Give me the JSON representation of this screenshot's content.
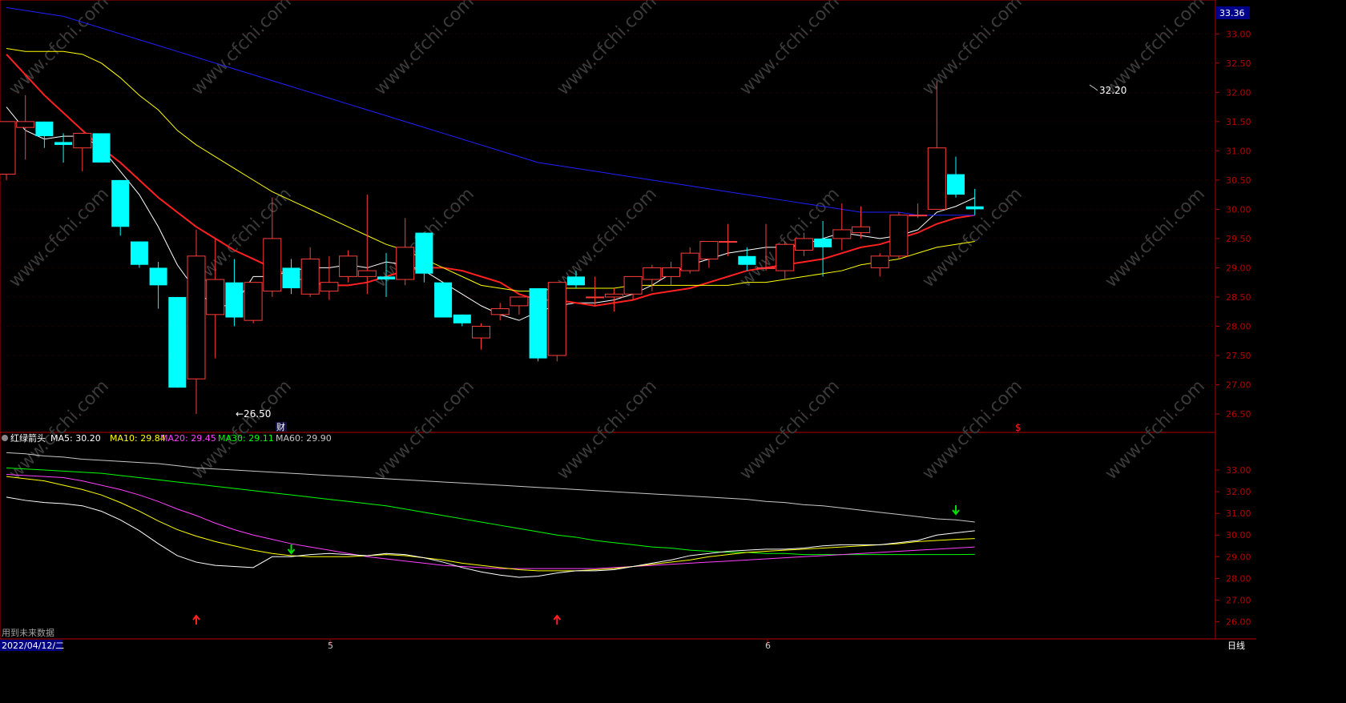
{
  "colors": {
    "background": "#000000",
    "up": "#ff3c3c",
    "down": "#00ffff",
    "grid": "#3a0000",
    "axis": "#b40000",
    "ma5": "#ffffff",
    "ma10": "#ffff00",
    "ma20": "#ff40ff",
    "ma30": "#00ff00",
    "ma60": "#c8c8c8",
    "ma60_main": "#2020ff",
    "ma20_main": "#ff2020"
  },
  "price_axis": {
    "current": "33.36",
    "ticks": [
      "33.00",
      "32.50",
      "32.00",
      "31.50",
      "31.00",
      "30.50",
      "30.00",
      "29.50",
      "29.00",
      "28.50",
      "28.00",
      "27.50",
      "27.00",
      "26.50"
    ]
  },
  "indicator_axis": {
    "ticks": [
      "33.00",
      "32.00",
      "31.00",
      "30.00",
      "29.00",
      "28.00",
      "27.00",
      "26.00"
    ]
  },
  "annotations": {
    "high_label": "32.20",
    "low_label": "←26.50",
    "finance_marker": "财",
    "dollar_marker": "$"
  },
  "indicator_legend": {
    "name": "红绿箭头",
    "ma5": "MA5: 30.20",
    "ma10": "MA10: 29.84",
    "ma20": "MA20: 29.45",
    "ma30": "MA30: 29.11",
    "ma60": "MA60: 29.90"
  },
  "footer": {
    "future_data": "用到未来数据",
    "date": "2022/04/12/二",
    "month5": "5",
    "month6": "6",
    "period": "日线"
  },
  "chart_data": {
    "type": "candlestick",
    "ylim": [
      26.3,
      33.5
    ],
    "candles": [
      {
        "o": 30.6,
        "h": 31.2,
        "l": 30.5,
        "c": 31.5
      },
      {
        "o": 31.4,
        "h": 31.95,
        "l": 30.85,
        "c": 31.5
      },
      {
        "o": 31.5,
        "h": 31.5,
        "l": 31.05,
        "c": 31.25
      },
      {
        "o": 31.15,
        "h": 31.3,
        "l": 30.8,
        "c": 31.1
      },
      {
        "o": 31.05,
        "h": 31.3,
        "l": 30.65,
        "c": 31.3
      },
      {
        "o": 31.3,
        "h": 31.3,
        "l": 30.8,
        "c": 30.8
      },
      {
        "o": 30.5,
        "h": 30.5,
        "l": 29.55,
        "c": 29.7
      },
      {
        "o": 29.45,
        "h": 29.45,
        "l": 29.0,
        "c": 29.05
      },
      {
        "o": 29.0,
        "h": 29.1,
        "l": 28.3,
        "c": 28.7
      },
      {
        "o": 28.5,
        "h": 28.5,
        "l": 26.95,
        "c": 26.95
      },
      {
        "o": 27.1,
        "h": 29.65,
        "l": 26.5,
        "c": 29.2
      },
      {
        "o": 28.2,
        "h": 29.5,
        "l": 27.45,
        "c": 28.8
      },
      {
        "o": 28.75,
        "h": 29.15,
        "l": 28.0,
        "c": 28.15
      },
      {
        "o": 28.1,
        "h": 28.75,
        "l": 28.05,
        "c": 28.75
      },
      {
        "o": 28.6,
        "h": 30.2,
        "l": 28.5,
        "c": 29.5
      },
      {
        "o": 29.0,
        "h": 29.15,
        "l": 28.55,
        "c": 28.65
      },
      {
        "o": 28.55,
        "h": 29.35,
        "l": 28.5,
        "c": 29.15
      },
      {
        "o": 28.6,
        "h": 29.2,
        "l": 28.45,
        "c": 28.75
      },
      {
        "o": 28.85,
        "h": 29.3,
        "l": 28.75,
        "c": 29.2
      },
      {
        "o": 28.85,
        "h": 30.25,
        "l": 28.55,
        "c": 28.95
      },
      {
        "o": 28.85,
        "h": 29.25,
        "l": 28.5,
        "c": 28.8
      },
      {
        "o": 28.8,
        "h": 29.85,
        "l": 28.7,
        "c": 29.35
      },
      {
        "o": 29.6,
        "h": 29.6,
        "l": 28.75,
        "c": 28.9
      },
      {
        "o": 28.75,
        "h": 28.75,
        "l": 28.15,
        "c": 28.15
      },
      {
        "o": 28.2,
        "h": 28.2,
        "l": 28.0,
        "c": 28.05
      },
      {
        "o": 27.8,
        "h": 28.05,
        "l": 27.6,
        "c": 28.0
      },
      {
        "o": 28.2,
        "h": 28.4,
        "l": 28.1,
        "c": 28.3
      },
      {
        "o": 28.35,
        "h": 28.5,
        "l": 28.2,
        "c": 28.5
      },
      {
        "o": 28.65,
        "h": 28.65,
        "l": 27.4,
        "c": 27.45
      },
      {
        "o": 27.5,
        "h": 28.75,
        "l": 27.4,
        "c": 28.75
      },
      {
        "o": 28.85,
        "h": 28.95,
        "l": 28.65,
        "c": 28.7
      },
      {
        "o": 28.5,
        "h": 28.85,
        "l": 28.35,
        "c": 28.5
      },
      {
        "o": 28.5,
        "h": 28.65,
        "l": 28.25,
        "c": 28.55
      },
      {
        "o": 28.55,
        "h": 28.8,
        "l": 28.45,
        "c": 28.85
      },
      {
        "o": 28.8,
        "h": 29.05,
        "l": 28.6,
        "c": 29.0
      },
      {
        "o": 28.85,
        "h": 29.1,
        "l": 28.7,
        "c": 29.0
      },
      {
        "o": 28.95,
        "h": 29.35,
        "l": 28.9,
        "c": 29.25
      },
      {
        "o": 29.15,
        "h": 29.45,
        "l": 29.0,
        "c": 29.45
      },
      {
        "o": 29.45,
        "h": 29.75,
        "l": 29.2,
        "c": 29.45
      },
      {
        "o": 29.2,
        "h": 29.35,
        "l": 28.95,
        "c": 29.05
      },
      {
        "o": 29.0,
        "h": 29.75,
        "l": 28.95,
        "c": 29.0
      },
      {
        "o": 28.95,
        "h": 29.45,
        "l": 28.8,
        "c": 29.4
      },
      {
        "o": 29.3,
        "h": 29.6,
        "l": 29.2,
        "c": 29.5
      },
      {
        "o": 29.5,
        "h": 29.8,
        "l": 28.85,
        "c": 29.35
      },
      {
        "o": 29.5,
        "h": 30.1,
        "l": 29.3,
        "c": 29.65
      },
      {
        "o": 29.6,
        "h": 30.05,
        "l": 29.5,
        "c": 29.7
      },
      {
        "o": 29.0,
        "h": 29.25,
        "l": 28.85,
        "c": 29.2
      },
      {
        "o": 29.2,
        "h": 29.95,
        "l": 29.15,
        "c": 29.9
      },
      {
        "o": 29.9,
        "h": 30.1,
        "l": 29.85,
        "c": 29.9
      },
      {
        "o": 30.0,
        "h": 32.2,
        "l": 30.0,
        "c": 31.05
      },
      {
        "o": 30.6,
        "h": 30.9,
        "l": 30.2,
        "c": 30.25
      },
      {
        "o": 30.05,
        "h": 30.35,
        "l": 29.9,
        "c": 30.0
      }
    ],
    "overlays_main": [
      {
        "name": "MA5",
        "color": "#ffffff",
        "values": [
          31.75,
          31.35,
          31.2,
          31.25,
          31.25,
          31.05,
          30.65,
          30.25,
          29.7,
          29.05,
          28.6,
          28.35,
          28.35,
          28.85,
          28.85,
          28.95,
          29.0,
          29.0,
          29.05,
          29.0,
          29.1,
          29.05,
          28.95,
          28.75,
          28.55,
          28.35,
          28.2,
          28.1,
          28.25,
          28.35,
          28.4,
          28.4,
          28.45,
          28.55,
          28.7,
          28.9,
          29.05,
          29.15,
          29.25,
          29.3,
          29.35,
          29.35,
          29.4,
          29.5,
          29.6,
          29.55,
          29.5,
          29.55,
          29.65,
          29.95,
          30.05,
          30.2
        ]
      },
      {
        "name": "MA20",
        "color": "#ff2020",
        "values": [
          32.65,
          32.3,
          31.95,
          31.65,
          31.35,
          31.05,
          30.8,
          30.5,
          30.2,
          29.95,
          29.7,
          29.5,
          29.3,
          29.15,
          29.0,
          28.85,
          28.75,
          28.7,
          28.7,
          28.75,
          28.85,
          28.95,
          29.0,
          29.0,
          28.95,
          28.85,
          28.75,
          28.55,
          28.45,
          28.45,
          28.4,
          28.35,
          28.4,
          28.45,
          28.55,
          28.6,
          28.65,
          28.75,
          28.85,
          28.95,
          29.0,
          29.05,
          29.1,
          29.15,
          29.25,
          29.35,
          29.4,
          29.5,
          29.6,
          29.75,
          29.85,
          29.9
        ]
      },
      {
        "name": "MA10",
        "color": "#ffff00",
        "values": [
          32.75,
          32.7,
          32.7,
          32.7,
          32.65,
          32.5,
          32.25,
          31.95,
          31.7,
          31.35,
          31.1,
          30.9,
          30.7,
          30.5,
          30.3,
          30.15,
          30.0,
          29.85,
          29.7,
          29.55,
          29.4,
          29.3,
          29.15,
          29.0,
          28.85,
          28.7,
          28.65,
          28.6,
          28.6,
          28.65,
          28.65,
          28.65,
          28.65,
          28.7,
          28.7,
          28.7,
          28.7,
          28.7,
          28.7,
          28.75,
          28.75,
          28.8,
          28.85,
          28.9,
          28.95,
          29.05,
          29.1,
          29.15,
          29.25,
          29.35,
          29.4,
          29.45
        ]
      },
      {
        "name": "MA60",
        "color": "#2020ff",
        "values": [
          33.45,
          33.4,
          33.35,
          33.3,
          33.2,
          33.1,
          33.0,
          32.9,
          32.8,
          32.7,
          32.6,
          32.5,
          32.4,
          32.3,
          32.2,
          32.1,
          32.0,
          31.9,
          31.8,
          31.7,
          31.6,
          31.5,
          31.4,
          31.3,
          31.2,
          31.1,
          31.0,
          30.9,
          30.8,
          30.75,
          30.7,
          30.65,
          30.6,
          30.55,
          30.5,
          30.45,
          30.4,
          30.35,
          30.3,
          30.25,
          30.2,
          30.15,
          30.1,
          30.05,
          30.0,
          29.95,
          29.95,
          29.95,
          29.9,
          29.9,
          29.9,
          29.9
        ]
      }
    ],
    "indicator_series": [
      {
        "name": "MA60",
        "color": "#c8c8c8",
        "values": [
          33.8,
          33.75,
          33.65,
          33.6,
          33.5,
          33.45,
          33.4,
          33.35,
          33.3,
          33.2,
          33.1,
          33.05,
          33.0,
          32.95,
          32.9,
          32.85,
          32.8,
          32.75,
          32.7,
          32.65,
          32.6,
          32.55,
          32.5,
          32.45,
          32.4,
          32.35,
          32.3,
          32.25,
          32.2,
          32.15,
          32.1,
          32.05,
          32.0,
          31.95,
          31.9,
          31.85,
          31.8,
          31.75,
          31.7,
          31.65,
          31.55,
          31.5,
          31.4,
          31.35,
          31.25,
          31.15,
          31.05,
          30.95,
          30.85,
          30.75,
          30.7,
          30.6
        ]
      },
      {
        "name": "MA30",
        "color": "#00ff00",
        "values": [
          33.1,
          33.05,
          33.0,
          32.95,
          32.9,
          32.85,
          32.75,
          32.65,
          32.55,
          32.45,
          32.35,
          32.25,
          32.15,
          32.05,
          31.95,
          31.85,
          31.75,
          31.65,
          31.55,
          31.45,
          31.35,
          31.2,
          31.05,
          30.9,
          30.75,
          30.6,
          30.45,
          30.3,
          30.15,
          30.0,
          29.9,
          29.75,
          29.65,
          29.55,
          29.45,
          29.4,
          29.3,
          29.25,
          29.2,
          29.2,
          29.15,
          29.15,
          29.1,
          29.1,
          29.1,
          29.1,
          29.1,
          29.1,
          29.1,
          29.1,
          29.1,
          29.11
        ]
      },
      {
        "name": "MA20",
        "color": "#ff40ff",
        "values": [
          32.8,
          32.75,
          32.7,
          32.65,
          32.5,
          32.3,
          32.1,
          31.85,
          31.55,
          31.2,
          30.9,
          30.55,
          30.25,
          30.0,
          29.8,
          29.6,
          29.45,
          29.3,
          29.15,
          29.0,
          28.9,
          28.8,
          28.7,
          28.6,
          28.55,
          28.5,
          28.45,
          28.45,
          28.45,
          28.45,
          28.45,
          28.45,
          28.5,
          28.55,
          28.6,
          28.65,
          28.7,
          28.75,
          28.8,
          28.85,
          28.9,
          28.95,
          29.0,
          29.05,
          29.1,
          29.15,
          29.2,
          29.25,
          29.3,
          29.35,
          29.4,
          29.45
        ]
      },
      {
        "name": "MA10",
        "color": "#ffff00",
        "values": [
          32.7,
          32.6,
          32.5,
          32.3,
          32.1,
          31.85,
          31.5,
          31.1,
          30.65,
          30.25,
          29.95,
          29.7,
          29.5,
          29.3,
          29.15,
          29.05,
          29.0,
          29.0,
          29.0,
          29.05,
          29.1,
          29.05,
          28.95,
          28.85,
          28.7,
          28.6,
          28.5,
          28.4,
          28.35,
          28.35,
          28.35,
          28.4,
          28.45,
          28.55,
          28.65,
          28.75,
          28.85,
          29.0,
          29.1,
          29.2,
          29.25,
          29.3,
          29.35,
          29.4,
          29.45,
          29.5,
          29.55,
          29.6,
          29.7,
          29.75,
          29.8,
          29.84
        ]
      },
      {
        "name": "MA5",
        "color": "#ffffff",
        "values": [
          31.75,
          31.6,
          31.5,
          31.45,
          31.35,
          31.1,
          30.7,
          30.2,
          29.6,
          29.05,
          28.75,
          28.6,
          28.55,
          28.5,
          29.0,
          29.0,
          29.1,
          29.15,
          29.1,
          29.05,
          29.15,
          29.1,
          28.95,
          28.75,
          28.5,
          28.3,
          28.15,
          28.05,
          28.1,
          28.25,
          28.35,
          28.35,
          28.4,
          28.55,
          28.7,
          28.85,
          29.05,
          29.15,
          29.25,
          29.3,
          29.35,
          29.35,
          29.4,
          29.5,
          29.55,
          29.55,
          29.55,
          29.65,
          29.75,
          30.0,
          30.1,
          30.2
        ]
      }
    ],
    "indicator_ylim": [
      25.5,
      34.0
    ],
    "indicator_arrows": [
      {
        "index": 10,
        "dir": "up",
        "color": "#ff2020"
      },
      {
        "index": 15,
        "dir": "down",
        "color": "#00e000"
      },
      {
        "index": 29,
        "dir": "up",
        "color": "#ff2020"
      },
      {
        "index": 50,
        "dir": "down",
        "color": "#00e000"
      }
    ]
  }
}
